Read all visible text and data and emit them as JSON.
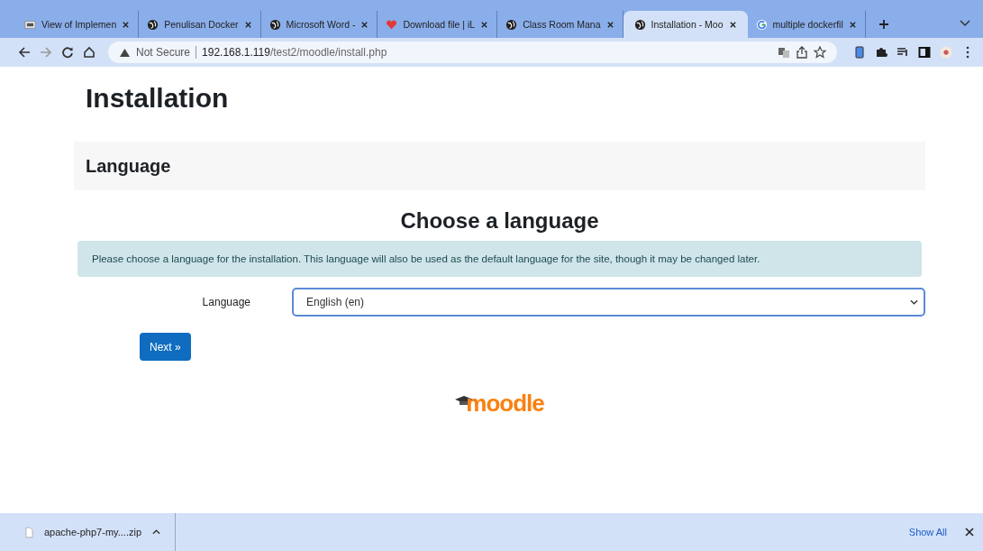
{
  "tabs": [
    {
      "title": "View of Implemen",
      "kind": "doc",
      "selected": false
    },
    {
      "title": "Penulisan Docker",
      "kind": "globe",
      "selected": false
    },
    {
      "title": "Microsoft Word -",
      "kind": "globe",
      "selected": false
    },
    {
      "title": "Download file | iL",
      "kind": "heart",
      "selected": false
    },
    {
      "title": "Class Room Mana",
      "kind": "globe",
      "selected": false
    },
    {
      "title": "Installation - Moo",
      "kind": "globe",
      "selected": true
    },
    {
      "title": "multiple dockerfil",
      "kind": "google",
      "selected": false
    }
  ],
  "address_bar": {
    "security": "Not Secure",
    "host": "192.168.1.119",
    "path": "/test2/moodle/install.php"
  },
  "page": {
    "title": "Installation",
    "section": "Language",
    "heading": "Choose a language",
    "notice": "Please choose a language for the installation. This language will also be used as the default language for the site, though it may be changed later.",
    "field_label": "Language",
    "field_value": "English (en)",
    "next_button": "Next »",
    "logo": "moodle"
  },
  "download_bar": {
    "file": "apache-php7-my....zip",
    "show_all": "Show All"
  }
}
